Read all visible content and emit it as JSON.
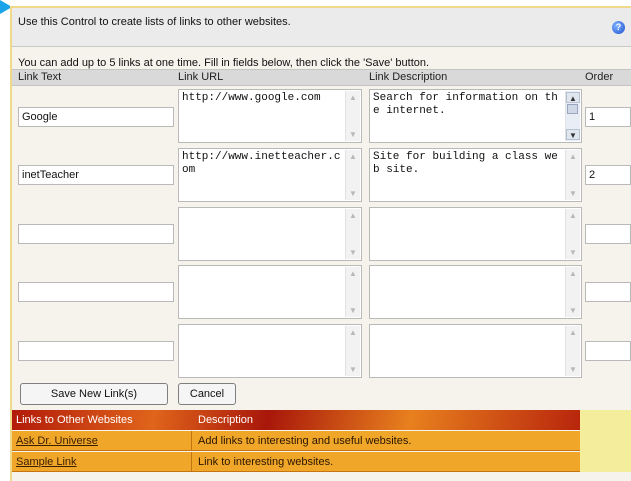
{
  "intro": "Use this Control to create lists of links to other websites.",
  "help_icon": "help-icon",
  "instructions": "You can add up to 5 links at one time. Fill in fields below, then click the 'Save' button.",
  "columns": [
    "Link Text",
    "Link URL",
    "Link Description",
    "Order"
  ],
  "rows": [
    {
      "text": "Google",
      "url": "http://www.google.com",
      "description": "Search for information on the internet.",
      "order": "1"
    },
    {
      "text": "inetTeacher",
      "url": "http://www.inetteacher.com",
      "description": "Site for building a class web site.",
      "order": "2"
    },
    {
      "text": "",
      "url": "",
      "description": "",
      "order": ""
    },
    {
      "text": "",
      "url": "",
      "description": "",
      "order": ""
    },
    {
      "text": "",
      "url": "",
      "description": "",
      "order": ""
    }
  ],
  "buttons": {
    "save": "Save New Link(s)",
    "cancel": "Cancel"
  },
  "links_table": {
    "headers": [
      "Links to Other Websites",
      "Description"
    ],
    "rows": [
      {
        "name": "Ask Dr. Universe",
        "description": "Add links to interesting and useful websites."
      },
      {
        "name": "Sample Link",
        "description": "Link to interesting websites."
      }
    ]
  },
  "colors": {
    "accent_arrow": "#1aa3e8",
    "header_red": "#b21a09",
    "row_orange": "#f0a629",
    "strip_yellow": "#f4ee9c"
  }
}
